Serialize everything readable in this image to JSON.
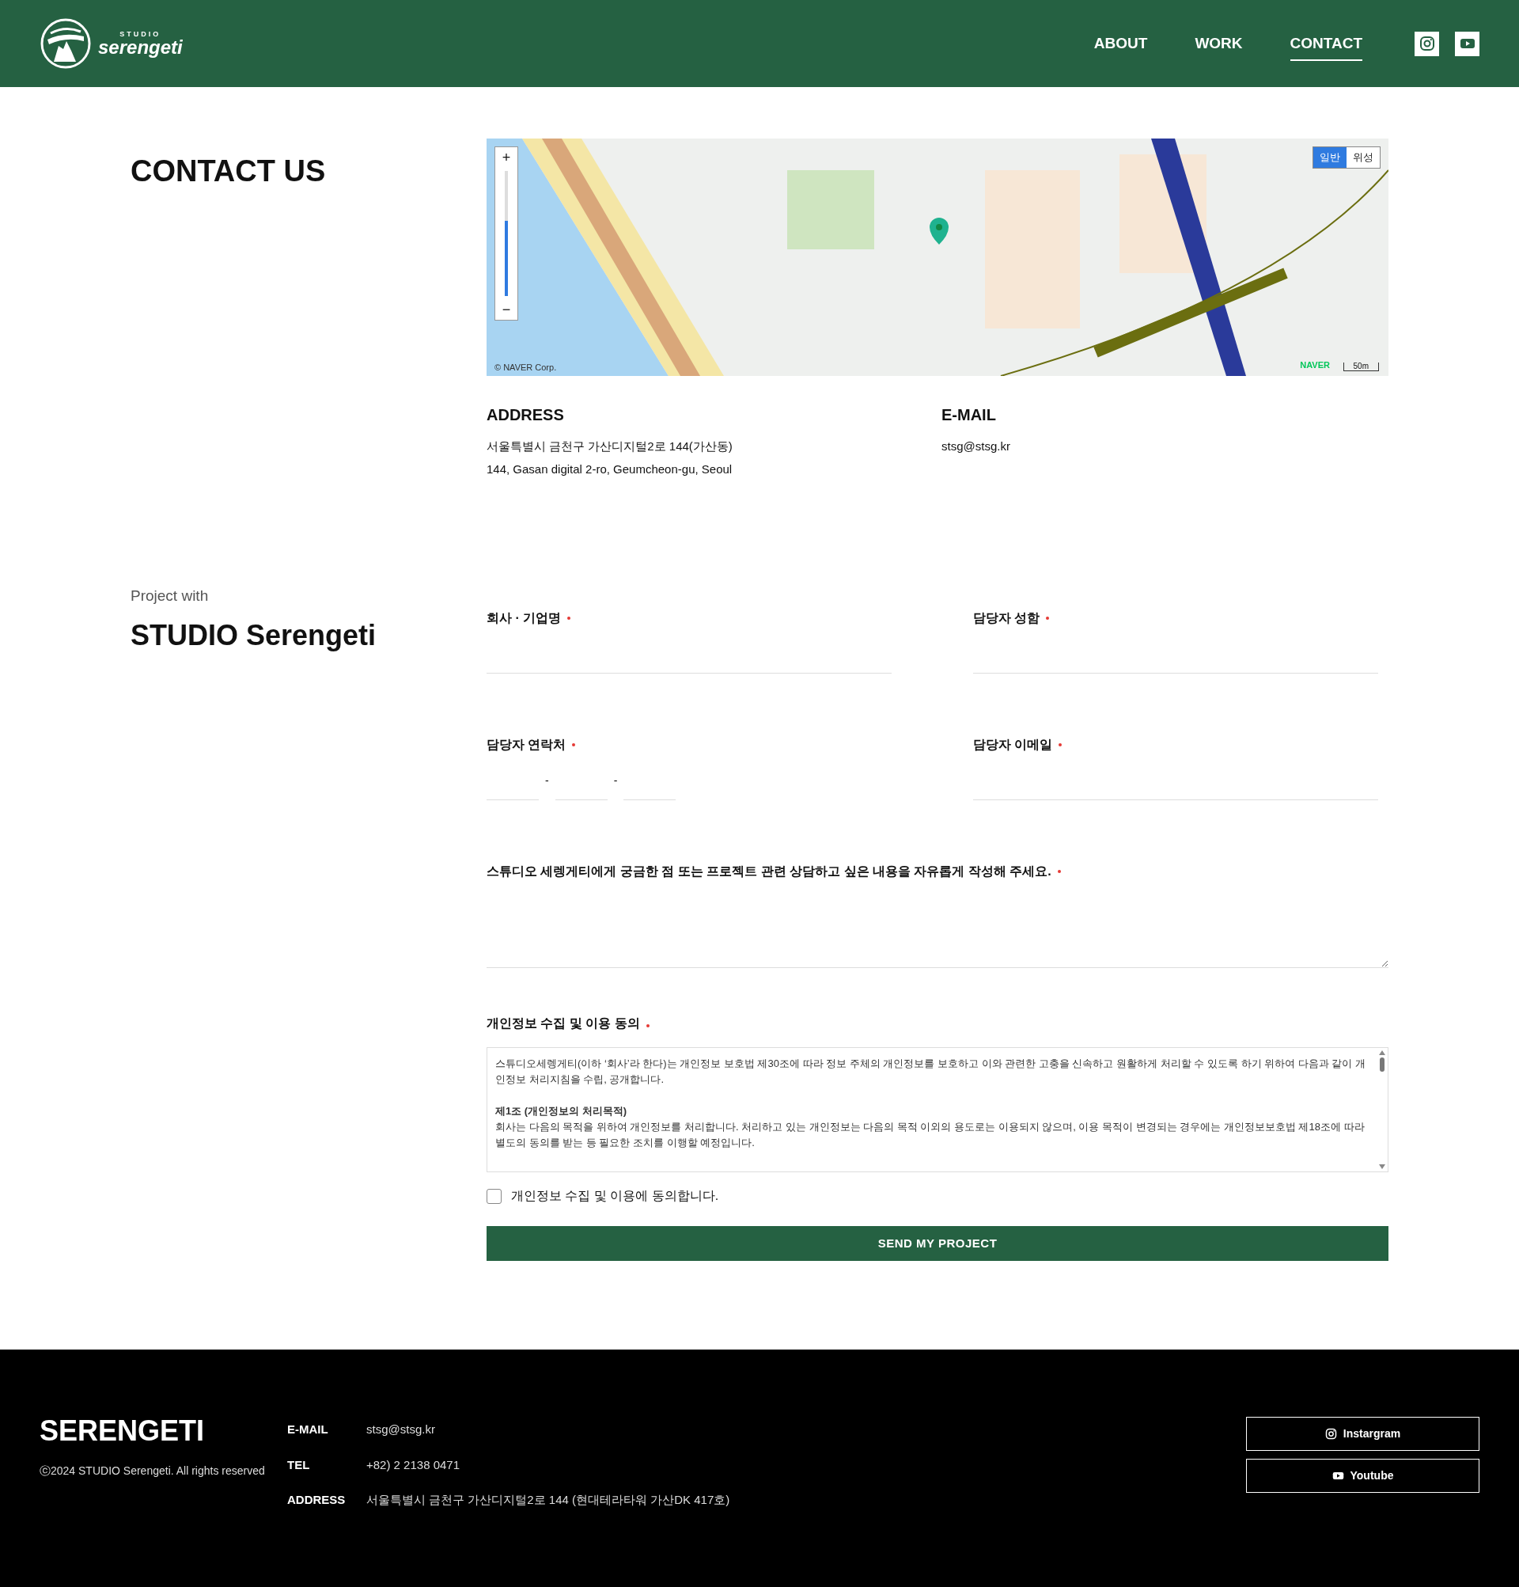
{
  "header": {
    "logo": {
      "top": "STUDIO",
      "name": "serengeti"
    },
    "nav": [
      {
        "label": "ABOUT",
        "selected": false
      },
      {
        "label": "WORK",
        "selected": false
      },
      {
        "label": "CONTACT",
        "selected": true
      }
    ],
    "social": [
      {
        "kind": "instagram"
      },
      {
        "kind": "youtube"
      }
    ]
  },
  "contact": {
    "title": "CONTACT US",
    "map": {
      "zoom_in": "+",
      "zoom_out": "−",
      "level": 0.6,
      "types": [
        {
          "label": "일반",
          "selected": true
        },
        {
          "label": "위성",
          "selected": false
        }
      ],
      "attribution": "© NAVER Corp.",
      "brand": "NAVER",
      "scale": "50m"
    },
    "address": {
      "heading": "ADDRESS",
      "lines": [
        "서울특별시 금천구 가산디지털2로 144(가산동)",
        "144, Gasan digital 2-ro, Geumcheon-gu, Seoul"
      ]
    },
    "email": {
      "heading": "E-MAIL",
      "value": "stsg@stsg.kr"
    }
  },
  "project": {
    "kicker": "Project with",
    "title": "STUDIO Serengeti",
    "fields": [
      {
        "label": "회사 · 기업명",
        "required": true,
        "kind": "text"
      },
      {
        "label": "담당자 성함",
        "required": true,
        "kind": "text"
      },
      {
        "label": "담당자 연락처",
        "required": true,
        "kind": "phone",
        "separators": [
          "-",
          "-"
        ]
      },
      {
        "label": "담당자 이메일",
        "required": true,
        "kind": "text"
      },
      {
        "label": "스튜디오 세렝게티에게 궁금한 점 또는 프로젝트 관련 상담하고 싶은 내용을 자유롭게 작성해 주세요.",
        "required": true,
        "kind": "textarea"
      }
    ],
    "privacy": {
      "label": "개인정보 수집 및 이용 동의",
      "required": true,
      "paragraphs": [
        {
          "text": "스튜디오세렝게티(이하 ‘회사’라 한다)는 개인정보 보호법 제30조에 따라 정보 주체의 개인정보를 보호하고 이와 관련한 고충을 신속하고 원활하게 처리할 수 있도록 하기 위하여 다음과 같이 개인정보 처리지침을 수립, 공개합니다."
        },
        {
          "heading": "제1조 (개인정보의 처리목적)",
          "text": "회사는 다음의 목적을 위하여 개인정보를 처리합니다. 처리하고 있는 개인정보는 다음의 목적 이외의 용도로는 이용되지 않으며, 이용 목적이 변경되는 경우에는 개인정보보호법 제18조에 따라 별도의 동의를 받는 등 필요한 조치를 이행할 예정입니다."
        }
      ],
      "agree": {
        "label": "개인정보 수집 및 이용에 동의합니다.",
        "checked": false
      }
    },
    "submit": "SEND MY PROJECT"
  },
  "footer": {
    "brand": "SERENGETI",
    "copyright": "ⓒ2024 STUDIO Serengeti. All rights reserved",
    "info": [
      {
        "label": "E-MAIL",
        "value": "stsg@stsg.kr"
      },
      {
        "label": "TEL",
        "value": "+82) 2 2138 0471"
      },
      {
        "label": "ADDRESS",
        "value": "서울특별시 금천구 가산디지털2로 144 (현대테라타워 가산DK 417호)"
      }
    ],
    "links": [
      {
        "kind": "instagram",
        "label": "Instargram"
      },
      {
        "kind": "youtube",
        "label": "Youtube"
      }
    ]
  }
}
